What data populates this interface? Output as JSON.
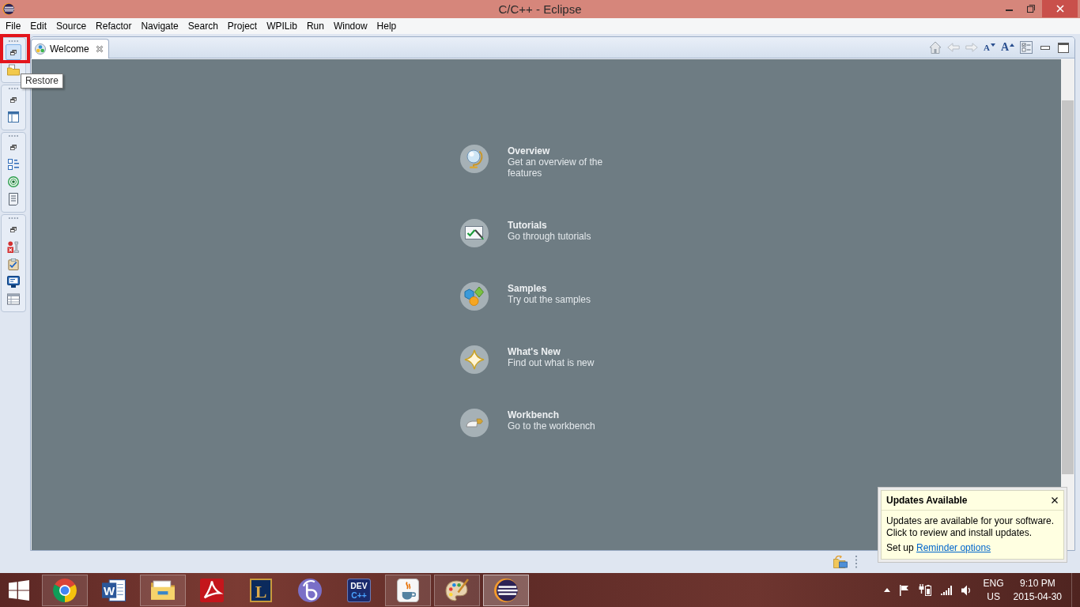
{
  "window": {
    "title": "C/C++ - Eclipse"
  },
  "menu": [
    "File",
    "Edit",
    "Source",
    "Refactor",
    "Navigate",
    "Search",
    "Project",
    "WPILib",
    "Run",
    "Window",
    "Help"
  ],
  "side_toolbar": [
    {
      "items": [
        {
          "kind": "restore",
          "hovered": true,
          "marked": true
        },
        {
          "kind": "folder",
          "hovered": false,
          "marked": false
        }
      ]
    },
    {
      "items": [
        {
          "kind": "restore",
          "hovered": false,
          "marked": false
        },
        {
          "kind": "layout",
          "hovered": false,
          "marked": false
        }
      ]
    },
    {
      "items": [
        {
          "kind": "restore",
          "hovered": false,
          "marked": false
        },
        {
          "kind": "outline",
          "hovered": false,
          "marked": false
        },
        {
          "kind": "target",
          "hovered": false,
          "marked": false
        },
        {
          "kind": "document",
          "hovered": false,
          "marked": false
        }
      ]
    },
    {
      "items": [
        {
          "kind": "restore",
          "hovered": false,
          "marked": false
        },
        {
          "kind": "breakpoints",
          "hovered": false,
          "marked": false
        },
        {
          "kind": "tasks",
          "hovered": false,
          "marked": false
        },
        {
          "kind": "console",
          "hovered": false,
          "marked": false
        },
        {
          "kind": "table",
          "hovered": false,
          "marked": false
        }
      ]
    }
  ],
  "tooltip": {
    "text": "Restore"
  },
  "editor": {
    "tabs": [
      {
        "label": "Welcome",
        "selected": true
      }
    ],
    "view_toolbar": [
      {
        "kind": "home"
      },
      {
        "kind": "back"
      },
      {
        "kind": "forward"
      },
      {
        "kind": "font_smaller",
        "glyph": "A"
      },
      {
        "kind": "font_larger",
        "glyph": "A"
      },
      {
        "kind": "contents"
      },
      {
        "kind": "minimize"
      },
      {
        "kind": "maximize"
      }
    ],
    "welcome_items": [
      {
        "kind": "overview",
        "title": "Overview",
        "description": "Get an overview of the features"
      },
      {
        "kind": "tutorials",
        "title": "Tutorials",
        "description": "Go through tutorials"
      },
      {
        "kind": "samples",
        "title": "Samples",
        "description": "Try out the samples"
      },
      {
        "kind": "whatsnew",
        "title": "What's New",
        "description": "Find out what is new"
      },
      {
        "kind": "workbench",
        "title": "Workbench",
        "description": "Go to the workbench"
      }
    ]
  },
  "notification": {
    "title": "Updates Available",
    "lines": [
      "Updates are available for your software.",
      "Click to review and install updates."
    ],
    "footer": {
      "text": "Set up",
      "link": "Reminder options"
    }
  },
  "taskbar": {
    "apps": [
      {
        "kind": "browser",
        "running": true,
        "selected": false
      },
      {
        "kind": "word",
        "glyphs": [
          "W"
        ],
        "running": false,
        "selected": false
      },
      {
        "kind": "folder",
        "running": true,
        "selected": false
      },
      {
        "kind": "pdf",
        "running": false,
        "selected": false
      },
      {
        "kind": "game",
        "glyphs": [
          "L"
        ],
        "running": false,
        "selected": false
      },
      {
        "kind": "torrent",
        "running": false,
        "selected": false
      },
      {
        "kind": "devcpp",
        "glyphs": [
          "DEV",
          "C++"
        ],
        "running": false,
        "selected": false
      },
      {
        "kind": "java",
        "running": true,
        "selected": false
      },
      {
        "kind": "paint",
        "running": true,
        "selected": false
      },
      {
        "kind": "eclipse",
        "running": true,
        "selected": true
      }
    ],
    "tray": {
      "language": "ENG",
      "region": "US",
      "time": "9:10 PM",
      "date": "2015-04-30"
    }
  }
}
